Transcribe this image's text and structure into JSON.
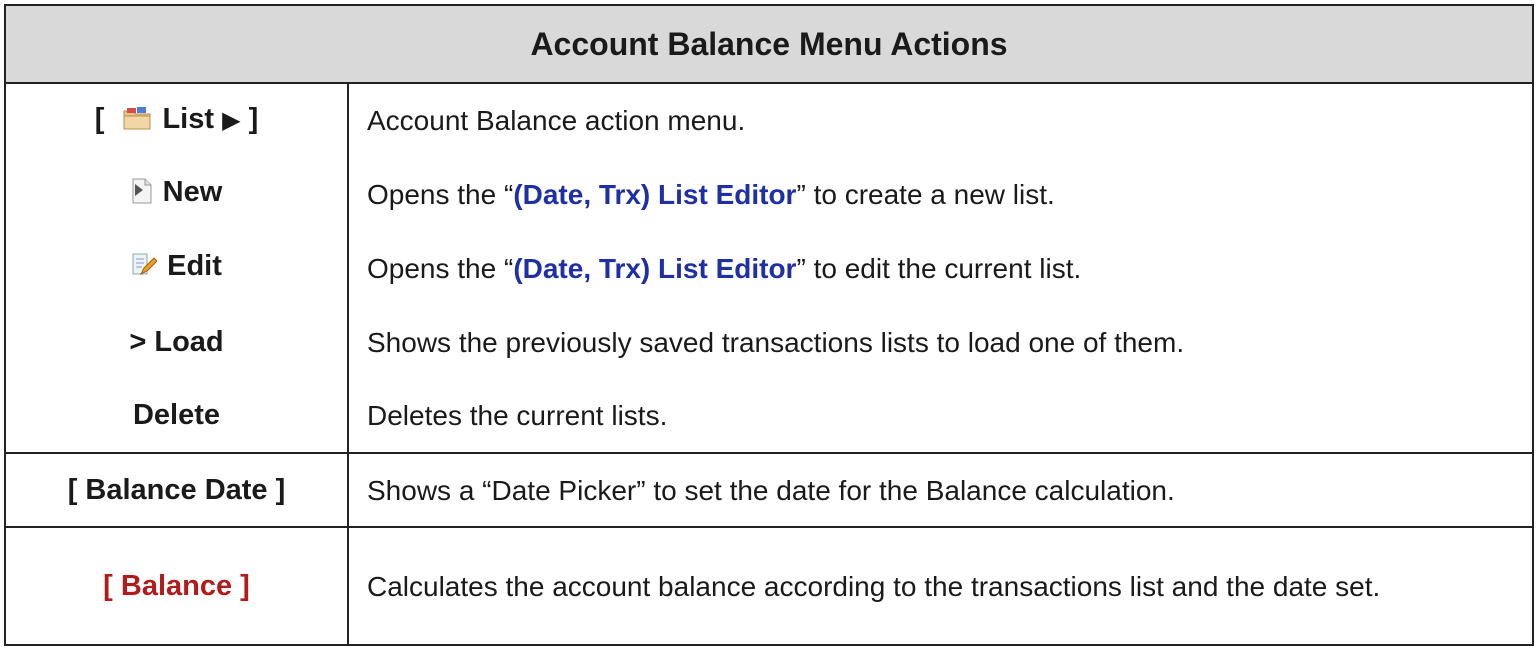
{
  "title": "Account Balance Menu Actions",
  "rows": [
    {
      "key_prefix": "[",
      "key_label": "List",
      "key_arrow": "▶",
      "key_suffix": "]",
      "icon": "folder-icon",
      "desc": "Account Balance action menu."
    },
    {
      "key_label": "New",
      "icon": "new-document-icon",
      "desc_before": "Opens the “",
      "desc_highlight": "(Date, Trx) List Editor",
      "desc_after": "” to create a new list."
    },
    {
      "key_label": "Edit",
      "icon": "edit-pencil-icon",
      "desc_before": "Opens the “",
      "desc_highlight": "(Date, Trx) List Editor",
      "desc_after": "” to edit the current list."
    },
    {
      "key_label": "> Load",
      "desc": "Shows the previously saved transactions lists to load one of them."
    },
    {
      "key_label": "Delete",
      "desc": "Deletes the current lists."
    },
    {
      "key_label": "[ Balance Date ]",
      "desc": "Shows a “Date Picker” to set the date for the Balance calculation."
    },
    {
      "key_label": "[ Balance ]",
      "desc": "Calculates the account balance according to the transactions list and the date set."
    }
  ],
  "colors": {
    "highlight": "#1f2fa6",
    "balance_key": "#b31b1b",
    "header_bg": "#d9d9d9"
  }
}
